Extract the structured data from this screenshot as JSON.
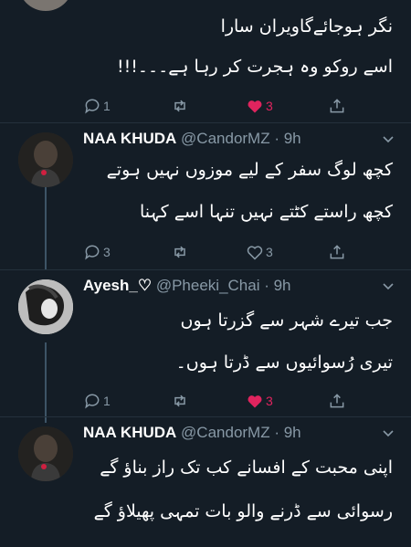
{
  "colors": {
    "background": "#141d26",
    "muted": "#8899a6",
    "like": "#e0245e",
    "thread_line": "#3d5466"
  },
  "tweets": [
    {
      "lines": [
        "نگر ہوجائےگاویران سارا",
        "اسے روکو وہ ہجرت کر رہا ہے۔۔۔!!!"
      ],
      "reply_count": "1",
      "retweet_count": "",
      "like_count": "3",
      "liked": true
    },
    {
      "name": "NAA KHUDA",
      "handle": "@CandorMZ",
      "time": "· 9h",
      "lines": [
        "کچھ لوگ سفر کے لیے موزوں نہیں ہوتے",
        "کچھ راستے کٹتے نہیں تنہا اسے کہنا"
      ],
      "reply_count": "3",
      "retweet_count": "",
      "like_count": "3",
      "liked": false
    },
    {
      "name": "Ayesh_♡",
      "handle": "@Pheeki_Chai",
      "time": "· 9h",
      "lines": [
        "جب تیرے شہر سے گزرتا ہوں",
        "تیری رُسوائیوں سے ڈرتا ہوں۔"
      ],
      "reply_count": "1",
      "retweet_count": "",
      "like_count": "3",
      "liked": true
    },
    {
      "name": "NAA KHUDA",
      "handle": "@CandorMZ",
      "time": "· 9h",
      "lines": [
        "اپنی محبت کے افسانے کب تک راز بناؤ گے",
        "رسوائی سے ڈرنے والو بات تمہی پھیلاؤ گے"
      ]
    }
  ]
}
